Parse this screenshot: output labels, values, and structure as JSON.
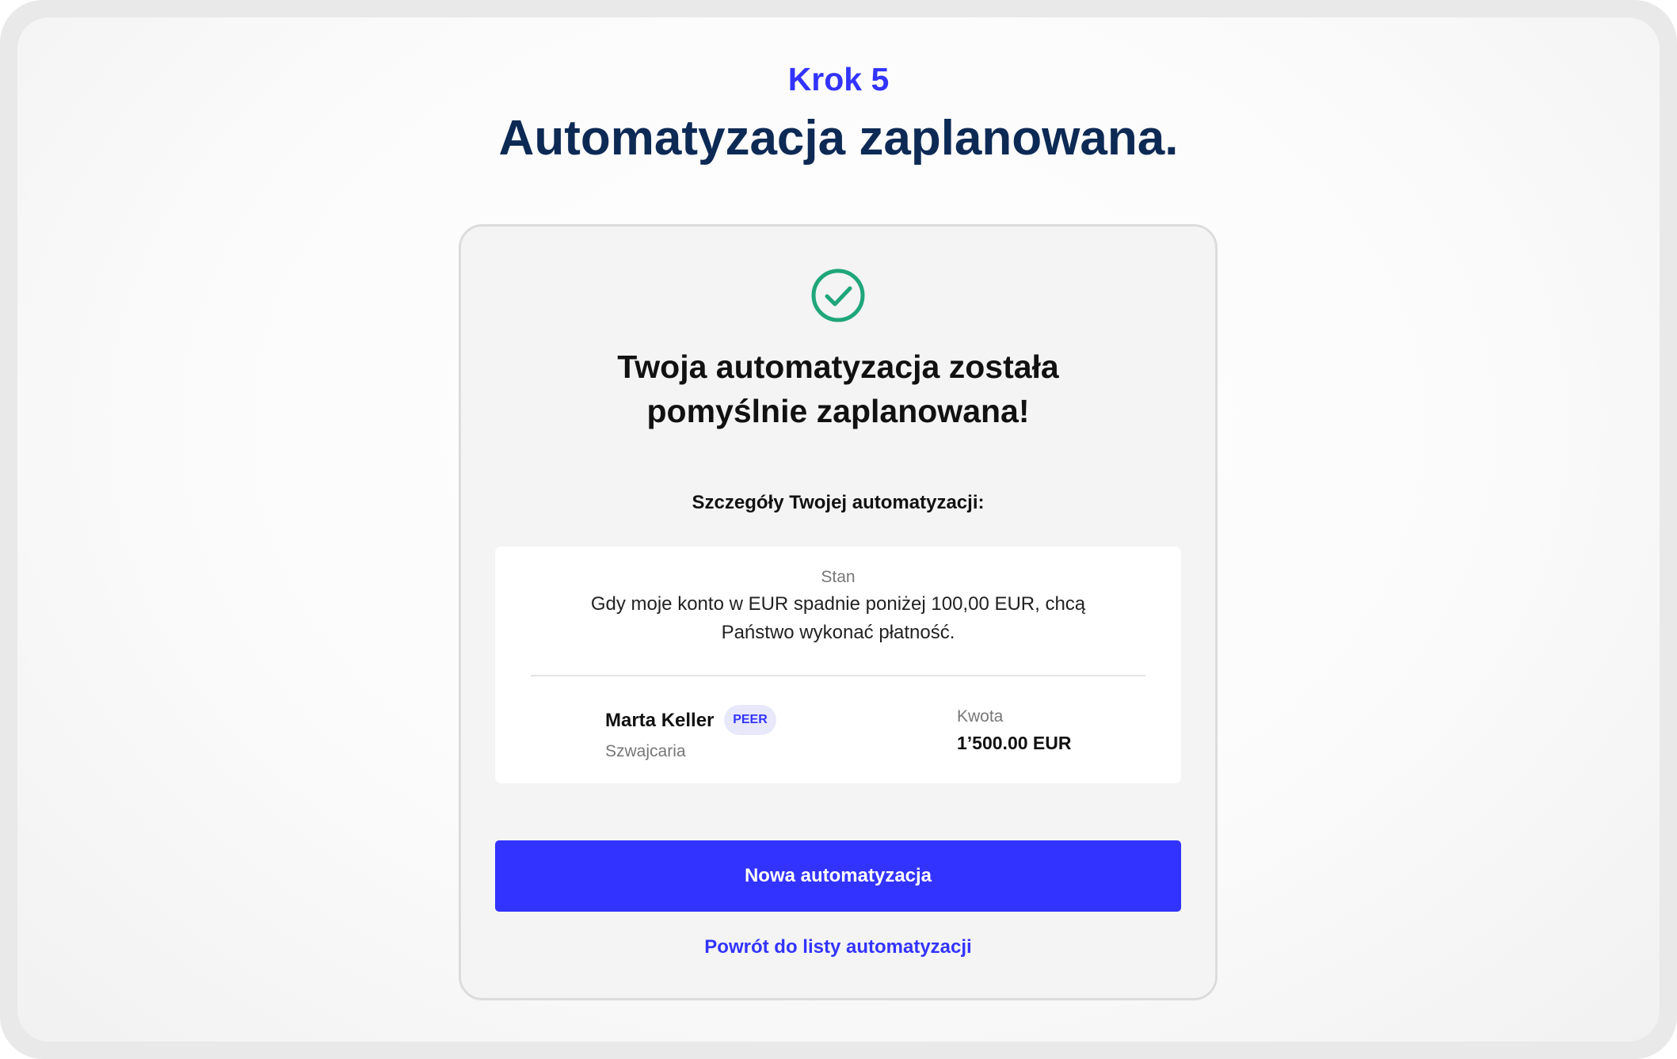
{
  "header": {
    "step_label": "Krok 5",
    "title": "Automatyzacja zaplanowana."
  },
  "card": {
    "success_icon": "check-circle-icon",
    "success_line1": "Twoja automatyzacja została",
    "success_line2": "pomyślnie zaplanowana!",
    "details_heading": "Szczegóły Twojej automatyzacji:",
    "condition": {
      "label": "Stan",
      "text_line1": "Gdy moje konto w EUR spadnie poniżej 100,00 EUR, chcą",
      "text_line2": "Państwo wykonać płatność."
    },
    "recipient": {
      "name": "Marta Keller",
      "badge": "PEER",
      "country": "Szwajcaria"
    },
    "amount": {
      "label": "Kwota",
      "value": "1’500.00 EUR"
    },
    "primary_button": "Nowa automatyzacja",
    "back_link": "Powrót do listy automatyzacji"
  },
  "colors": {
    "accent": "#3333ff",
    "title": "#0d2a55",
    "success": "#1fa67a"
  }
}
